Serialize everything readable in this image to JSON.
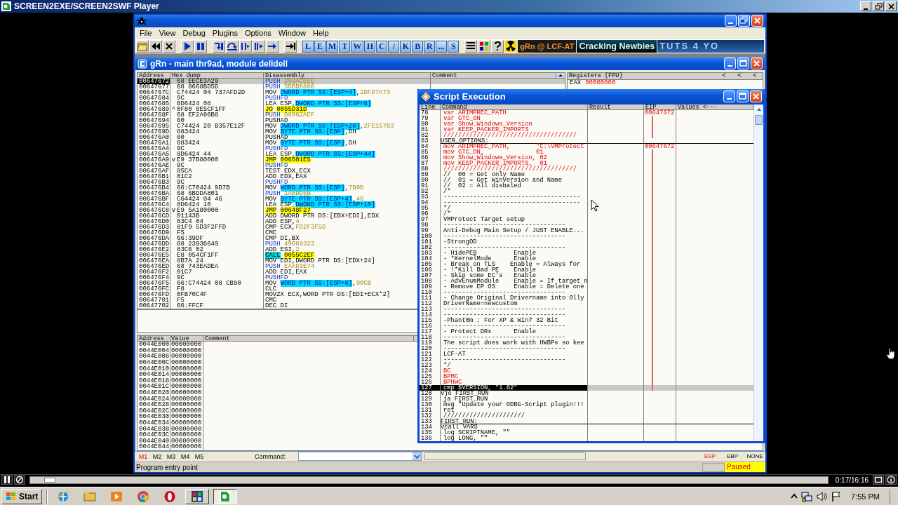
{
  "player": {
    "title": "SCREEN2EXE/SCREEN2SWF Player",
    "time": "0:17/16:16",
    "progress": {
      "level": 0.018
    }
  },
  "debugger": {
    "menu": [
      "File",
      "View",
      "Debug",
      "Plugins",
      "Options",
      "Window",
      "Help"
    ],
    "toolbar": {
      "letters": [
        "L",
        "E",
        "M",
        "T",
        "W",
        "H",
        "C",
        "/",
        "K",
        "B",
        "R",
        "...",
        "S"
      ],
      "banners": [
        "gRn @ LCF-AT",
        "Cracking Newbies",
        "TUTS 4 YO"
      ]
    },
    "cpu_window": {
      "title": "gRn - main thr9ad, module delldell",
      "disasm_columns": [
        "Address",
        "Hex dump",
        "Disassembly",
        "Comment"
      ],
      "disasm_rows": [
        {
          "address": "00647672",
          "hex": "68 EECE3A29",
          "selected": true,
          "parts": [
            {
              "text": "PUSH ",
              "kind": "blue"
            },
            {
              "text": "293ACEEE",
              "kind": "immediate"
            }
          ]
        },
        {
          "address": "00647677",
          "hex": "68 8668BD5D",
          "selected": false,
          "parts": [
            {
              "text": "PUSH ",
              "kind": "blue"
            },
            {
              "text": "5DBD6886",
              "kind": "immediate"
            }
          ]
        },
        {
          "address": "0064767C",
          "hex": "C74424 04 737AFD2D",
          "selected": false,
          "parts": [
            {
              "text": "MOV ",
              "kind": "plain"
            },
            {
              "text": "DWORD PTR SS:[ESP+4]",
              "kind": "memory"
            },
            {
              "text": ",",
              "kind": "plain"
            },
            {
              "text": "2DFD7A73",
              "kind": "immediate"
            }
          ]
        },
        {
          "address": "00647684",
          "hex": "9C",
          "selected": false,
          "parts": [
            {
              "text": "PUSHFD",
              "kind": "blue"
            }
          ]
        },
        {
          "address": "00647685",
          "hex": "8D6424 08",
          "selected": false,
          "parts": [
            {
              "text": "LEA ESP,",
              "kind": "plain"
            },
            {
              "text": "DWORD PTR SS:[ESP+8]",
              "kind": "memory"
            }
          ]
        },
        {
          "address": "00647689",
          "jump": "^",
          "hex": "0F80 8E5CF1FF",
          "selected": false,
          "parts": [
            {
              "text": "JO",
              "kind": "jump"
            },
            {
              "text": "0055D31D",
              "kind": "jump"
            }
          ]
        },
        {
          "address": "0064768F",
          "hex": "68 EF2A96B8",
          "selected": false,
          "parts": [
            {
              "text": "PUSH ",
              "kind": "blue"
            },
            {
              "text": "B8962AEF",
              "kind": "immediate"
            }
          ]
        },
        {
          "address": "00647694",
          "hex": "60",
          "selected": false,
          "parts": [
            {
              "text": "PUSHAD",
              "kind": "plain"
            }
          ]
        },
        {
          "address": "00647695",
          "hex": "C74424 20 B357E12F",
          "selected": false,
          "parts": [
            {
              "text": "MOV ",
              "kind": "plain"
            },
            {
              "text": "DWORD PTR SS:[ESP+20]",
              "kind": "memory"
            },
            {
              "text": ",",
              "kind": "plain"
            },
            {
              "text": "2FE157B3",
              "kind": "immediate"
            }
          ]
        },
        {
          "address": "0064769D",
          "hex": "883424",
          "selected": false,
          "parts": [
            {
              "text": "MOV ",
              "kind": "plain"
            },
            {
              "text": "BYTE PTR SS:[ESP]",
              "kind": "memory"
            },
            {
              "text": ",DH",
              "kind": "plain"
            }
          ]
        },
        {
          "address": "006476A0",
          "hex": "60",
          "selected": false,
          "parts": [
            {
              "text": "PUSHAD",
              "kind": "plain"
            }
          ]
        },
        {
          "address": "006476A1",
          "hex": "883424",
          "selected": false,
          "parts": [
            {
              "text": "MOV ",
              "kind": "plain"
            },
            {
              "text": "BYTE PTR SS:[ESP]",
              "kind": "memory"
            },
            {
              "text": ",DH",
              "kind": "plain"
            }
          ]
        },
        {
          "address": "006476A4",
          "hex": "9C",
          "selected": false,
          "parts": [
            {
              "text": "PUSHFD",
              "kind": "blue"
            }
          ]
        },
        {
          "address": "006476A5",
          "hex": "8D6424 44",
          "selected": false,
          "parts": [
            {
              "text": "LEA ESP,",
              "kind": "plain"
            },
            {
              "text": "DWORD PTR SS:[ESP+44]",
              "kind": "memory"
            }
          ]
        },
        {
          "address": "006476A9",
          "jump": "v",
          "hex": "E9 37B80000",
          "selected": false,
          "parts": [
            {
              "text": "JMP",
              "kind": "jump"
            },
            {
              "text": "006501E5",
              "kind": "jump"
            }
          ]
        },
        {
          "address": "006476AE",
          "hex": "9C",
          "selected": false,
          "parts": [
            {
              "text": "PUSHFD",
              "kind": "blue"
            }
          ]
        },
        {
          "address": "006476AF",
          "hex": "85CA",
          "selected": false,
          "parts": [
            {
              "text": "TEST EDX,ECX",
              "kind": "plain"
            }
          ]
        },
        {
          "address": "006476B1",
          "hex": "01C2",
          "selected": false,
          "parts": [
            {
              "text": "ADD EDX,EAX",
              "kind": "plain"
            }
          ]
        },
        {
          "address": "006476B3",
          "hex": "9C",
          "selected": false,
          "parts": [
            {
              "text": "PUSHFD",
              "kind": "blue"
            }
          ]
        },
        {
          "address": "006476B4",
          "hex": "66:C70424 9D7B",
          "selected": false,
          "parts": [
            {
              "text": "MOV ",
              "kind": "plain"
            },
            {
              "text": "WORD PTR SS:[ESP]",
              "kind": "memory"
            },
            {
              "text": ",",
              "kind": "plain"
            },
            {
              "text": "7B9D",
              "kind": "immediate"
            }
          ]
        },
        {
          "address": "006476BA",
          "hex": "68 6BDDA801",
          "selected": false,
          "parts": [
            {
              "text": "PUSH ",
              "kind": "blue"
            },
            {
              "text": "1A8DD6B",
              "kind": "immediate"
            }
          ]
        },
        {
          "address": "006476BF",
          "hex": "C64424 04 46",
          "selected": false,
          "parts": [
            {
              "text": "MOV ",
              "kind": "plain"
            },
            {
              "text": "BYTE PTR SS:[ESP+4]",
              "kind": "memory"
            },
            {
              "text": ",",
              "kind": "plain"
            },
            {
              "text": "46",
              "kind": "immediate"
            }
          ]
        },
        {
          "address": "006476C4",
          "hex": "8D6424 10",
          "selected": false,
          "parts": [
            {
              "text": "LEA ESP,",
              "kind": "plain"
            },
            {
              "text": "DWORD PTR SS:[ESP+10]",
              "kind": "memory"
            }
          ]
        },
        {
          "address": "006476C8",
          "jump": "v",
          "hex": "E9 5A180000",
          "selected": false,
          "parts": [
            {
              "text": "JMP",
              "kind": "jump"
            },
            {
              "text": "00648F27",
              "kind": "jump"
            }
          ]
        },
        {
          "address": "006476CD",
          "hex": "01143B",
          "selected": false,
          "parts": [
            {
              "text": "ADD DWORD PTR DS:[EBX+EDI],EDX",
              "kind": "plain"
            }
          ]
        },
        {
          "address": "006476D0",
          "hex": "83C4 04",
          "selected": false,
          "parts": [
            {
              "text": "ADD ESP,",
              "kind": "plain"
            },
            {
              "text": "4",
              "kind": "immediate"
            }
          ]
        },
        {
          "address": "006476D3",
          "hex": "81F9 5D3F2FFD",
          "selected": false,
          "parts": [
            {
              "text": "CMP ECX,",
              "kind": "plain"
            },
            {
              "text": "FD2F3F5D",
              "kind": "immediate"
            }
          ]
        },
        {
          "address": "006476D9",
          "hex": "F5",
          "selected": false,
          "parts": [
            {
              "text": "CMC",
              "kind": "plain"
            }
          ]
        },
        {
          "address": "006476DA",
          "hex": "66:39DF",
          "selected": false,
          "parts": [
            {
              "text": "CMP DI,BX",
              "kind": "plain"
            }
          ]
        },
        {
          "address": "006476DD",
          "hex": "68 23936649",
          "selected": false,
          "parts": [
            {
              "text": "PUSH ",
              "kind": "blue"
            },
            {
              "text": "49669323",
              "kind": "immediate"
            }
          ]
        },
        {
          "address": "006476E2",
          "hex": "83C6 02",
          "selected": false,
          "parts": [
            {
              "text": "ADD ESI,",
              "kind": "plain"
            },
            {
              "text": "2",
              "kind": "immediate"
            }
          ]
        },
        {
          "address": "006476E5",
          "hex": "E8 054CF1FF",
          "selected": false,
          "parts": [
            {
              "text": "CALL",
              "kind": "call"
            },
            {
              "text": "0055C2EF",
              "kind": "jump"
            }
          ]
        },
        {
          "address": "006476EA",
          "hex": "8B7A 24",
          "selected": false,
          "parts": [
            {
              "text": "MOV EDI,DWORD PTR DS:[EDX+24]",
              "kind": "plain"
            }
          ]
        },
        {
          "address": "006476ED",
          "hex": "68 743EADEA",
          "selected": false,
          "parts": [
            {
              "text": "PUSH ",
              "kind": "blue"
            },
            {
              "text": "EAAD3E74",
              "kind": "immediate"
            }
          ]
        },
        {
          "address": "006476F2",
          "hex": "01C7",
          "selected": false,
          "parts": [
            {
              "text": "ADD EDI,EAX",
              "kind": "plain"
            }
          ]
        },
        {
          "address": "006476F4",
          "hex": "9C",
          "selected": false,
          "parts": [
            {
              "text": "PUSHFD",
              "kind": "blue"
            }
          ]
        },
        {
          "address": "006476F5",
          "hex": "66:C74424 08 CB90",
          "selected": false,
          "parts": [
            {
              "text": "MOV ",
              "kind": "plain"
            },
            {
              "text": "WORD PTR SS:[ESP+8]",
              "kind": "memory"
            },
            {
              "text": ",",
              "kind": "plain"
            },
            {
              "text": "90CB",
              "kind": "immediate"
            }
          ]
        },
        {
          "address": "006476FC",
          "hex": "F8",
          "selected": false,
          "parts": [
            {
              "text": "CLC",
              "kind": "plain"
            }
          ]
        },
        {
          "address": "006476FD",
          "hex": "0FB70C4F",
          "selected": false,
          "parts": [
            {
              "text": "MOVZX ECX,WORD PTR DS:[EDI+ECX*2]",
              "kind": "plain"
            }
          ]
        },
        {
          "address": "00647701",
          "hex": "F5",
          "selected": false,
          "parts": [
            {
              "text": "CMC",
              "kind": "plain"
            }
          ]
        },
        {
          "address": "00647702",
          "hex": "66:FFCF",
          "selected": false,
          "parts": [
            {
              "text": "DEC DI",
              "kind": "plain"
            }
          ]
        }
      ],
      "registers": {
        "title": "Registers (FPU)",
        "arrows": [
          "<",
          "<",
          "<"
        ],
        "name": "EAX",
        "value": "00000000"
      },
      "dump_columns": [
        "Address",
        "Value",
        "Comment"
      ],
      "dump_rows": [
        [
          "0044E000",
          "00000000"
        ],
        [
          "0044E004",
          "00000000"
        ],
        [
          "0044E008",
          "00000000"
        ],
        [
          "0044E00C",
          "00000000"
        ],
        [
          "0044E010",
          "00000000"
        ],
        [
          "0044E014",
          "00000000"
        ],
        [
          "0044E018",
          "00000000"
        ],
        [
          "0044E01C",
          "00000000"
        ],
        [
          "0044E020",
          "00000000"
        ],
        [
          "0044E024",
          "00000000"
        ],
        [
          "0044E028",
          "00000000"
        ],
        [
          "0044E02C",
          "00000000"
        ],
        [
          "0044E030",
          "00000000"
        ],
        [
          "0044E034",
          "00000000"
        ],
        [
          "0044E038",
          "00000000"
        ],
        [
          "0044E03C",
          "00000000"
        ],
        [
          "0044E040",
          "00000000"
        ],
        [
          "0044E044",
          "00000000"
        ]
      ]
    },
    "script_window": {
      "title": "Script Execution",
      "columns": [
        "Line",
        "Command",
        "Result",
        "EIP",
        "Values <---"
      ],
      "rows": [
        {
          "line": "78",
          "text": "var ARIMPREC_PATH",
          "kind": "active",
          "eip": "00647672",
          "traced": false,
          "selected": false
        },
        {
          "line": "79",
          "text": "var GTC_ON",
          "kind": "active",
          "traced": true,
          "selected": false
        },
        {
          "line": "80",
          "text": "var Show_Windows_Version",
          "kind": "active",
          "traced": true,
          "selected": false
        },
        {
          "line": "81",
          "text": "var KEEP_PACKER_IMPORTS",
          "kind": "active",
          "traced": true,
          "selected": false
        },
        {
          "line": "82",
          "text": "////////////////////////////////////",
          "kind": "active",
          "traced": true,
          "selected": false
        },
        {
          "line": "83",
          "text": "USER_OPTIONS:",
          "kind": "label",
          "traced": false,
          "selected": false
        },
        {
          "line": "84",
          "text": "mov ARIMPREC_PATH,       \"C:\\VMProtect",
          "kind": "active",
          "eip": "00647672",
          "traced": false,
          "selected": false
        },
        {
          "line": "85",
          "text": "mov GTC_ON,              01",
          "kind": "active",
          "traced": true,
          "selected": false
        },
        {
          "line": "86",
          "text": "mov Show_Windows_Version, 02",
          "kind": "active",
          "traced": true,
          "selected": false
        },
        {
          "line": "87",
          "text": "mov KEEP_PACKER_IMPORTS,  01",
          "kind": "active",
          "traced": true,
          "selected": false
        },
        {
          "line": "88",
          "text": "////////////////////////////////////",
          "kind": "active",
          "traced": true,
          "selected": false
        },
        {
          "line": "89",
          "text": "//  00 = Get only Name",
          "kind": "plain",
          "traced": true,
          "selected": false
        },
        {
          "line": "90",
          "text": "//  01 = Get WinVersion and Name",
          "kind": "plain",
          "traced": true,
          "selected": false
        },
        {
          "line": "91",
          "text": "//  02 = All disbaled",
          "kind": "plain",
          "traced": true,
          "selected": false
        },
        {
          "line": "92",
          "text": "/*",
          "kind": "plain",
          "traced": true,
          "selected": false
        },
        {
          "line": "93",
          "text": "-------------------------------------",
          "kind": "plain",
          "traced": true,
          "selected": false
        },
        {
          "line": "94",
          "text": "-------------------------------------",
          "kind": "plain",
          "traced": true,
          "selected": false
        },
        {
          "line": "95",
          "text": "*/",
          "kind": "plain",
          "traced": true,
          "selected": false
        },
        {
          "line": "96",
          "text": "/*",
          "kind": "plain",
          "traced": true,
          "selected": false
        },
        {
          "line": "97",
          "text": "VMProtect Target setup",
          "kind": "plain",
          "traced": true,
          "selected": false
        },
        {
          "line": "98",
          "text": "---------------------------------",
          "kind": "plain",
          "traced": true,
          "selected": false
        },
        {
          "line": "99",
          "text": "Anti-Debug Main Setup / JUST ENABLE...",
          "kind": "plain",
          "traced": true,
          "selected": false
        },
        {
          "line": "100",
          "text": "---------------------------------",
          "kind": "plain",
          "traced": true,
          "selected": false
        },
        {
          "line": "101",
          "text": "-StrongOD",
          "kind": "plain",
          "traced": true,
          "selected": false
        },
        {
          "line": "102",
          "text": "---------------------------------",
          "kind": "plain",
          "traced": true,
          "selected": false
        },
        {
          "line": "103",
          "text": "- HidePEB          Enable",
          "kind": "plain",
          "traced": true,
          "selected": false
        },
        {
          "line": "104",
          "text": "- *KernelMode      Enable",
          "kind": "plain",
          "traced": true,
          "selected": false
        },
        {
          "line": "105",
          "text": "- Break on TLS    Enable = Always for",
          "kind": "plain",
          "traced": true,
          "selected": false
        },
        {
          "line": "106",
          "text": "- !*Kill Bad PE    Enable",
          "kind": "plain",
          "traced": true,
          "selected": false
        },
        {
          "line": "107",
          "text": "- Skip some EC's   Enable",
          "kind": "plain",
          "traced": true,
          "selected": false
        },
        {
          "line": "108",
          "text": "- AdvEnumModule    Enable = If target n",
          "kind": "plain",
          "traced": true,
          "selected": false
        },
        {
          "line": "109",
          "text": "- Remove EP OS     Enable = Delete one",
          "kind": "plain",
          "traced": true,
          "selected": false
        },
        {
          "line": "110",
          "text": "---------------------------------",
          "kind": "plain",
          "traced": true,
          "selected": false
        },
        {
          "line": "111",
          "text": "- Change Original Drivername into Olly",
          "kind": "plain",
          "traced": true,
          "selected": false
        },
        {
          "line": "112",
          "text": "DriverName=newcustom",
          "kind": "plain",
          "traced": true,
          "selected": false
        },
        {
          "line": "113",
          "text": "---------------------------------",
          "kind": "plain",
          "traced": true,
          "selected": false
        },
        {
          "line": "114",
          "text": "---------------------------------",
          "kind": "plain",
          "traced": true,
          "selected": false
        },
        {
          "line": "115",
          "text": "-Phant0m : For XP & Win7 32 Bit",
          "kind": "plain",
          "traced": true,
          "selected": false
        },
        {
          "line": "116",
          "text": "---------------------------------",
          "kind": "plain",
          "traced": true,
          "selected": false
        },
        {
          "line": "117",
          "text": "- Protect DRx      Enable",
          "kind": "plain",
          "traced": true,
          "selected": false
        },
        {
          "line": "118",
          "text": "---------------------------------",
          "kind": "plain",
          "traced": true,
          "selected": false
        },
        {
          "line": "119",
          "text": "The script does work with HWBPs so kee",
          "kind": "plain",
          "traced": true,
          "selected": false
        },
        {
          "line": "120",
          "text": "---------------------------------",
          "kind": "plain",
          "traced": true,
          "selected": false
        },
        {
          "line": "121",
          "text": "LCF-AT",
          "kind": "plain",
          "traced": true,
          "selected": false
        },
        {
          "line": "122",
          "text": "---------------------------------",
          "kind": "plain",
          "traced": true,
          "selected": false
        },
        {
          "line": "123",
          "text": "*/",
          "kind": "plain",
          "traced": true,
          "selected": false
        },
        {
          "line": "124",
          "text": "BC",
          "kind": "active",
          "traced": true,
          "selected": false
        },
        {
          "line": "125",
          "text": "BPMC",
          "kind": "active",
          "traced": true,
          "selected": false
        },
        {
          "line": "126",
          "text": "BPHWC",
          "kind": "active",
          "traced": true,
          "selected": false
        },
        {
          "line": "127",
          "text": "cmp $VERSION, \"1.82\"",
          "kind": "plain",
          "traced": true,
          "selected": true
        },
        {
          "line": "128",
          "marker": "v",
          "text": "je FIRST_RUN",
          "kind": "plain",
          "traced": false,
          "selected": false
        },
        {
          "line": "129",
          "text": "ja FIRST_RUN",
          "kind": "plain",
          "traced": false,
          "selected": false
        },
        {
          "line": "130",
          "text": "msg \"Update your ODBG-Script plugin!!!",
          "kind": "plain",
          "traced": false,
          "selected": false
        },
        {
          "line": "131",
          "text": "ret",
          "kind": "plain",
          "traced": false,
          "selected": false
        },
        {
          "line": "132",
          "text": "//////////////////////",
          "kind": "plain",
          "traced": false,
          "selected": false
        },
        {
          "line": "133",
          "text": "FIRST_RUN:",
          "kind": "label",
          "traced": false,
          "selected": false
        },
        {
          "line": "134",
          "marker": "v",
          "text": "call VARS",
          "kind": "plain",
          "traced": false,
          "selected": false
        },
        {
          "line": "135",
          "text": "log SCRIPTNAME, \"\"",
          "kind": "plain",
          "traced": false,
          "selected": false
        },
        {
          "line": "136",
          "text": "log LONG, \"\"",
          "kind": "plain",
          "traced": false,
          "selected": false
        }
      ]
    },
    "bookmarks": [
      {
        "label": "M1",
        "selected": true
      },
      {
        "label": "M2",
        "selected": false
      },
      {
        "label": "M3",
        "selected": false
      },
      {
        "label": "M4",
        "selected": false
      },
      {
        "label": "M5",
        "selected": false
      }
    ],
    "command_label": "Command:",
    "registers_toggle": [
      {
        "label": "ESP",
        "selected": true
      },
      {
        "label": "EBP",
        "selected": false
      },
      {
        "label": "NONE",
        "selected": false
      }
    ],
    "status": "Program entry point",
    "state": "Paused"
  },
  "taskbar": {
    "start": "Start",
    "clock": "7:55 PM"
  }
}
